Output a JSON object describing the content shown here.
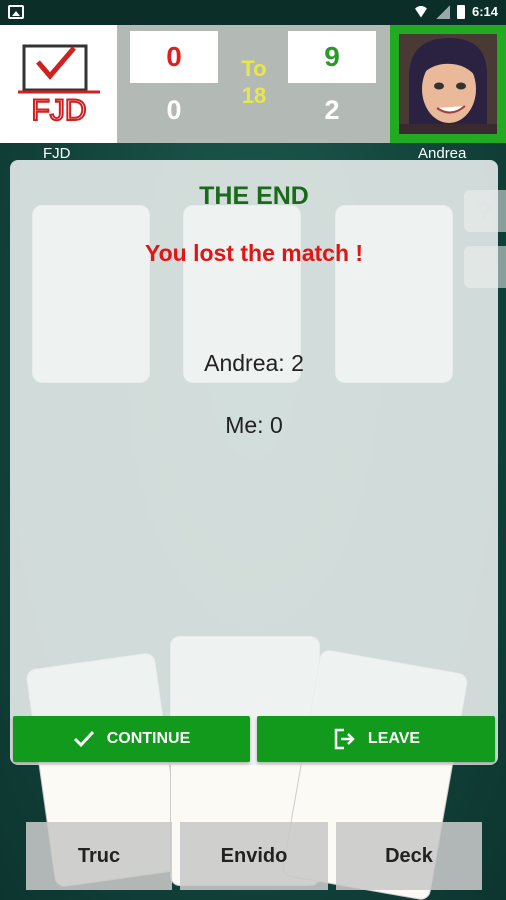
{
  "status_bar": {
    "time": "6:14",
    "icons": [
      "image-icon",
      "wifi-icon",
      "signal-icon",
      "battery-icon"
    ]
  },
  "header": {
    "logo_text": "FJD",
    "my_score": "0",
    "opponent_score": "9",
    "my_games": "0",
    "opponent_games": "2",
    "to_label": "To",
    "target": "18",
    "my_name": "FJD",
    "opponent_name": "Andrea"
  },
  "side_buttons": {
    "help": "?",
    "sound_icon": "speaker-icon"
  },
  "dialog": {
    "title": "THE END",
    "result": "You lost the match !",
    "score_opponent": "Andrea: 2",
    "score_me": "Me: 0",
    "continue_label": "CONTINUE",
    "leave_label": "LEAVE"
  },
  "bottom_bar": {
    "truc": "Truc",
    "envido": "Envido",
    "deck": "Deck"
  },
  "colors": {
    "felt": "#12433b",
    "accent_green": "#119a1b",
    "loss_red": "#e01515",
    "title_green": "#1a6a1a"
  }
}
